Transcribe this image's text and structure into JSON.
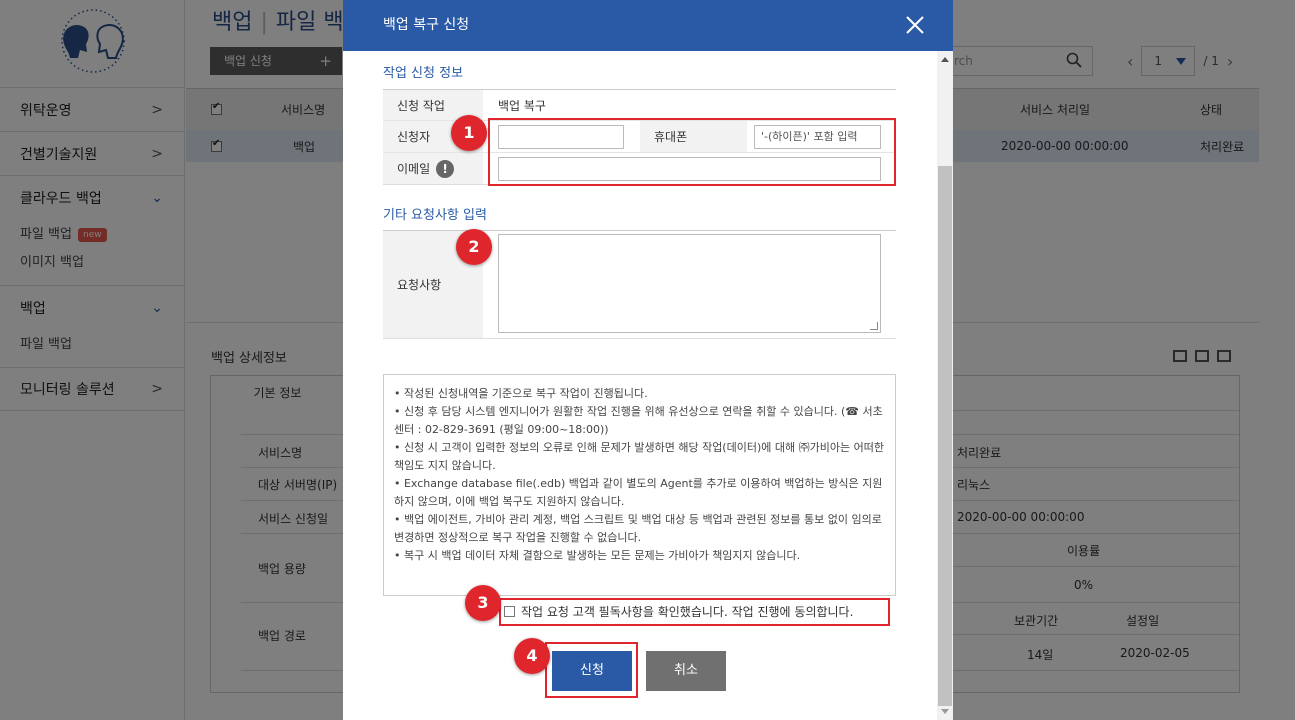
{
  "sidebar": {
    "items": [
      {
        "label": "위탁운영",
        "expanded": false
      },
      {
        "label": "건별기술지원",
        "expanded": false
      },
      {
        "label": "클라우드 백업",
        "expanded": true,
        "sub": [
          "파일 백업",
          "이미지 백업"
        ],
        "badge": "new"
      },
      {
        "label": "백업",
        "expanded": true,
        "sub": [
          "파일 백업"
        ]
      },
      {
        "label": "모니터링 솔루션",
        "expanded": false
      }
    ]
  },
  "page": {
    "title_main": "백업",
    "title_sub": "파일 백",
    "apply_button": "백업 신청",
    "search_placeholder": "rch",
    "pager": {
      "current": "1",
      "total": "/ 1"
    }
  },
  "table": {
    "headers": [
      "서비스명",
      "서비스 처리일",
      "상태"
    ],
    "row": {
      "service": "백업",
      "processed": "2020-00-00 00:00:00",
      "status": "처리완료"
    }
  },
  "detail": {
    "title": "백업 상세정보",
    "tab": "기본 정보",
    "labels": [
      "서비스명",
      "대상 서버명(IP)",
      "서비스 신청일",
      "백업 용량",
      "백업 경로"
    ],
    "values": {
      "status": "처리완료",
      "os": "리눅스",
      "date": "2020-00-00 00:00:00",
      "usage_header": "이용률",
      "usage": "0%",
      "retention_header": "보관기간",
      "setdate_header": "설정일",
      "retention": "14일",
      "setdate": "2020-02-05"
    }
  },
  "modal": {
    "title": "백업 복구 신청",
    "section1": "작업 신청 정보",
    "labels": {
      "task": "신청 작업",
      "applicant": "신청자",
      "phone": "휴대폰",
      "email": "이메일",
      "request": "요청사항"
    },
    "task_value": "백업 복구",
    "applicant_value": "",
    "phone_placeholder": "'-(하이픈)' 포함 입력",
    "email_value": "",
    "section2": "기타 요청사항 입력",
    "notice": [
      "• 작성된 신청내역을 기준으로 복구 작업이 진행됩니다.",
      "• 신청 후 담당 시스템 엔지니어가 원활한 작업 진행을 위해 유선상으로 연락을 취할 수 있습니다. (☎ 서초센터 : 02-829-3691 (평일 09:00~18:00))",
      "• 신청 시 고객이 입력한 정보의 오류로 인해 문제가 발생하면 해당 작업(데이터)에 대해 ㈜가비아는 어떠한 책임도 지지 않습니다.",
      "• Exchange database file(.edb) 백업과 같이 별도의 Agent를 추가로 이용하여 백업하는 방식은 지원하지 않으며, 이에 백업 복구도 지원하지 않습니다.",
      "• 백업 에이전트, 가비아 관리 계정, 백업 스크립트 및 백업 대상 등 백업과 관련된 정보를 통보 없이 임의로 변경하면 정상적으로 복구 작업을 진행할 수 없습니다.",
      "• 복구 시 백업 데이터 자체 결함으로 발생하는 모든 문제는 가비아가 책임지지 않습니다."
    ],
    "agree_text": "작업 요청 고객 필독사항을 확인했습니다. 작업 진행에 동의합니다.",
    "submit": "신청",
    "cancel": "취소"
  },
  "markers": [
    "1",
    "2",
    "3",
    "4"
  ],
  "colors": {
    "accent": "#2a5aa6",
    "highlight": "#e0262d"
  }
}
